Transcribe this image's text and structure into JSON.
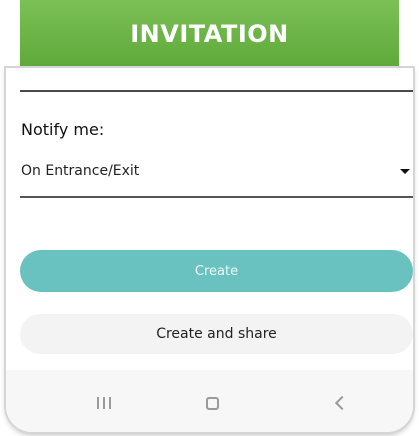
{
  "banner": {
    "title": "INVITATION"
  },
  "form": {
    "previous_field_value": "",
    "notify_label": "Notify me:",
    "notify_value": "On Entrance/Exit",
    "dropdown_icon": "caret-down-icon"
  },
  "actions": {
    "create_label": "Create",
    "create_share_label": "Create and share"
  },
  "navbar": {
    "recent_icon": "recent-apps-icon",
    "home_icon": "home-icon",
    "back_icon": "back-icon"
  },
  "colors": {
    "banner": "#6ab545",
    "create_button": "#69c2c0",
    "share_button": "#f3f3f3"
  }
}
